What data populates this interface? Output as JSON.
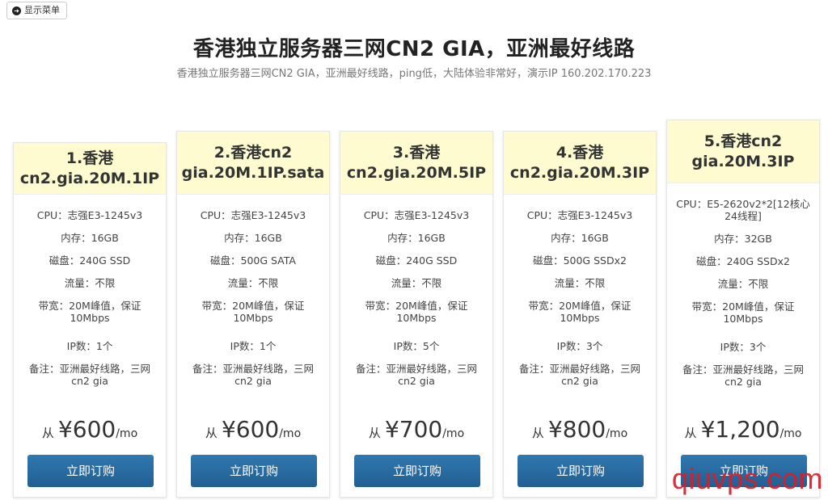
{
  "menu": {
    "label": "显示菜单",
    "icon": "arrow-circle-icon"
  },
  "header": {
    "title": "香港独立服务器三网CN2 GIA，亚洲最好线路",
    "subtitle": "香港独立服务器三网CN2 GIA，亚洲最好线路，ping低，大陆体验非常好，演示IP 160.202.170.223"
  },
  "plans": [
    {
      "name": "1.香港 cn2.gia.20M.1IP",
      "features": [
        "CPU：志强E3-1245v3",
        "内存：16GB",
        "磁盘：240G SSD",
        "流量：不限",
        "带宽：20M峰值，保证10Mbps",
        "IP数：1个",
        "备注：亚洲最好线路，三网cn2 gia"
      ],
      "price_prefix": "从",
      "price": "¥600",
      "price_unit": "/mo",
      "order_label": "立即订购"
    },
    {
      "name": "2.香港cn2 gia.20M.1IP.sata",
      "features": [
        "CPU：志强E3-1245v3",
        "内存：16GB",
        "磁盘：500G SATA",
        "流量：不限",
        "带宽：20M峰值，保证10Mbps",
        "IP数：1个",
        "备注：亚洲最好线路，三网cn2 gia"
      ],
      "price_prefix": "从",
      "price": "¥600",
      "price_unit": "/mo",
      "order_label": "立即订购"
    },
    {
      "name": "3.香港 cn2.gia.20M.5IP",
      "features": [
        "CPU：志强E3-1245v3",
        "内存：16GB",
        "磁盘：240G SSD",
        "流量：不限",
        "带宽：20M峰值，保证10Mbps",
        "IP数：5个",
        "备注：亚洲最好线路，三网cn2 gia"
      ],
      "price_prefix": "从",
      "price": "¥700",
      "price_unit": "/mo",
      "order_label": "立即订购"
    },
    {
      "name": "4.香港 cn2.gia.20M.3IP",
      "features": [
        "CPU：志强E3-1245v3",
        "内存：16GB",
        "磁盘：500G SSDx2",
        "流量：不限",
        "带宽：20M峰值，保证10Mbps",
        "IP数：3个",
        "备注：亚洲最好线路，三网cn2 gia"
      ],
      "price_prefix": "从",
      "price": "¥800",
      "price_unit": "/mo",
      "order_label": "立即订购"
    },
    {
      "name": "5.香港cn2 gia.20M.3IP",
      "features": [
        "CPU：E5-2620v2*2[12核心24线程]",
        "内存：32GB",
        "磁盘：240G SSDx2",
        "流量：不限",
        "带宽：20M峰值，保证10Mbps",
        "IP数：3个",
        "备注：亚洲最好线路，三网cn2 gia"
      ],
      "price_prefix": "从",
      "price": "¥1,200",
      "price_unit": "/mo",
      "order_label": "立即订购"
    }
  ],
  "watermark": "qiuvps.com",
  "colors": {
    "card_header_bg": "#fffbd0",
    "button_blue": "#2568a0",
    "watermark_red": "#d81e2a"
  }
}
